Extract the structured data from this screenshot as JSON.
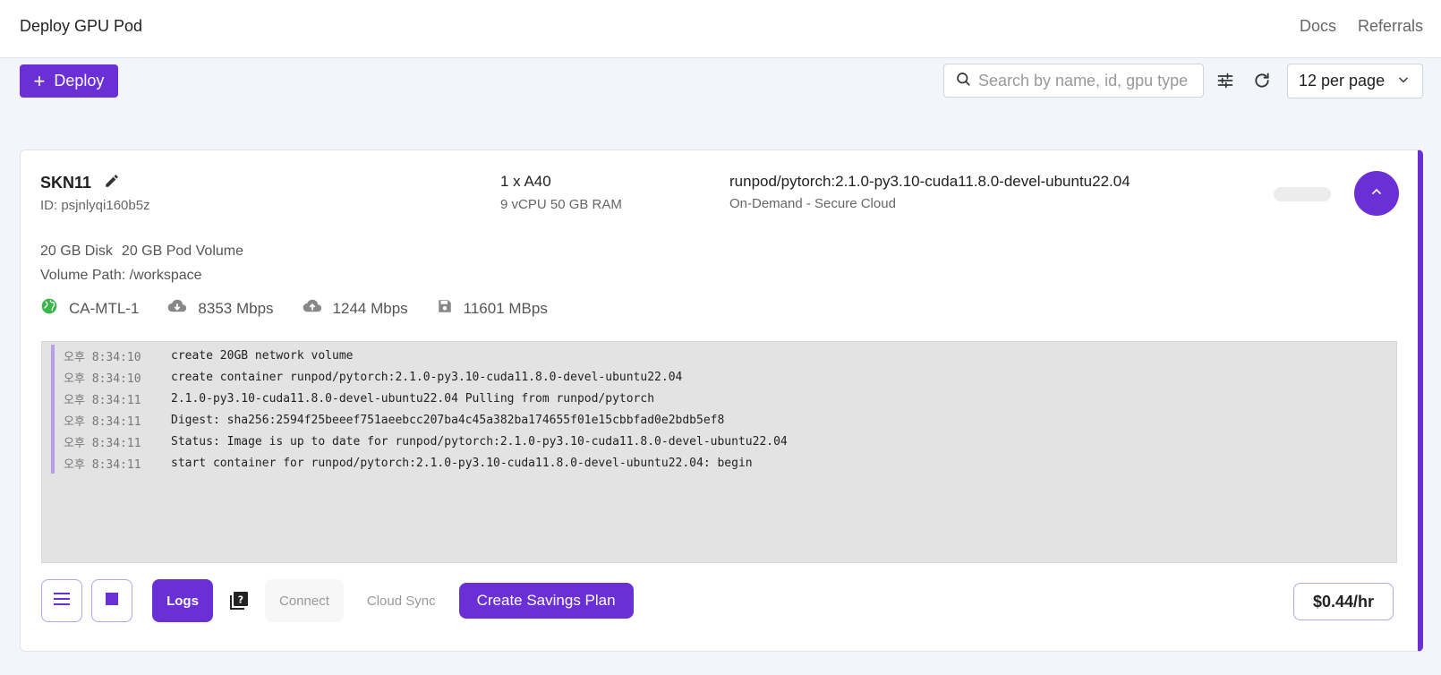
{
  "header": {
    "title": "Deploy GPU Pod",
    "nav": [
      "Docs",
      "Referrals"
    ]
  },
  "toolbar": {
    "deploy_label": "Deploy",
    "search_placeholder": "Search by name, id, gpu type",
    "per_page": "12 per page"
  },
  "pod": {
    "name": "SKN11",
    "id": "ID: psjnlyqi160b5z",
    "gpu": "1 x A40",
    "cpu_ram": "9 vCPU 50 GB RAM",
    "image": "runpod/pytorch:2.1.0-py3.10-cuda11.8.0-devel-ubuntu22.04",
    "cloud": "On-Demand - Secure Cloud",
    "disk": "20 GB Disk",
    "pod_volume": "20 GB Pod Volume",
    "volume_path": "Volume Path: /workspace",
    "region": "CA-MTL-1",
    "download": "8353 Mbps",
    "upload": "1244 Mbps",
    "disk_speed": "11601 MBps",
    "price": "$0.44/hr"
  },
  "logs": [
    {
      "time": "오후 8:34:10",
      "msg": "create 20GB network volume"
    },
    {
      "time": "오후 8:34:10",
      "msg": "create container runpod/pytorch:2.1.0-py3.10-cuda11.8.0-devel-ubuntu22.04"
    },
    {
      "time": "오후 8:34:11",
      "msg": "2.1.0-py3.10-cuda11.8.0-devel-ubuntu22.04 Pulling from runpod/pytorch"
    },
    {
      "time": "오후 8:34:11",
      "msg": "Digest: sha256:2594f25beeef751aeebcc207ba4c45a382ba174655f01e15cbbfad0e2bdb5ef8"
    },
    {
      "time": "오후 8:34:11",
      "msg": "Status: Image is up to date for runpod/pytorch:2.1.0-py3.10-cuda11.8.0-devel-ubuntu22.04"
    },
    {
      "time": "오후 8:34:11",
      "msg": "start container for runpod/pytorch:2.1.0-py3.10-cuda11.8.0-devel-ubuntu22.04: begin"
    }
  ],
  "actions": {
    "logs": "Logs",
    "connect": "Connect",
    "cloud_sync": "Cloud Sync",
    "savings": "Create Savings Plan"
  },
  "colors": {
    "accent": "#6b2fd6",
    "region_icon": "#3bb54a"
  }
}
